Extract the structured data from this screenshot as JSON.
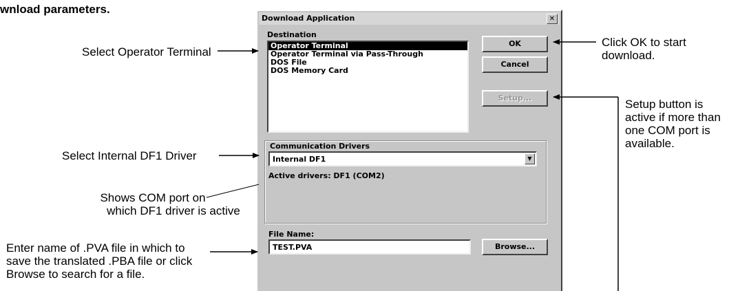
{
  "heading": "wnload parameters.",
  "dialog": {
    "title": "Download Application",
    "close_glyph": "✕",
    "destination_label": "Destination",
    "destinations": [
      "Operator Terminal",
      "Operator Terminal via Pass-Through",
      "DOS File",
      "DOS Memory Card"
    ],
    "selected_destination": "Operator Terminal",
    "buttons": {
      "ok": "OK",
      "cancel": "Cancel",
      "setup": "Setup...",
      "browse": "Browse..."
    },
    "setup_enabled": false,
    "comm_drivers_label": "Communication Drivers",
    "comm_driver_value": "Internal DF1",
    "active_drivers": "Active drivers: DF1 (COM2)",
    "file_name_label": "File Name:",
    "file_name_value": "TEST.PVA"
  },
  "callouts": {
    "select_terminal": "Select Operator Terminal",
    "select_driver": "Select Internal DF1 Driver",
    "com_port_line1": "Shows COM port on",
    "com_port_line2": "which DF1 driver is active",
    "enter_name_line1": "Enter name of .PVA file in which to",
    "enter_name_line2": "save the translated .PBA file or click",
    "enter_name_line3": "Browse to search for a file.",
    "ok_line1": "Click OK to start",
    "ok_line2": "download.",
    "setup_line1": "Setup button is",
    "setup_line2": "active if more than",
    "setup_line3": "one COM port is",
    "setup_line4": "available."
  },
  "colors": {
    "dialog_bg": "#c6c6c6",
    "selection_bg": "#000000",
    "selection_fg": "#ffffff"
  }
}
